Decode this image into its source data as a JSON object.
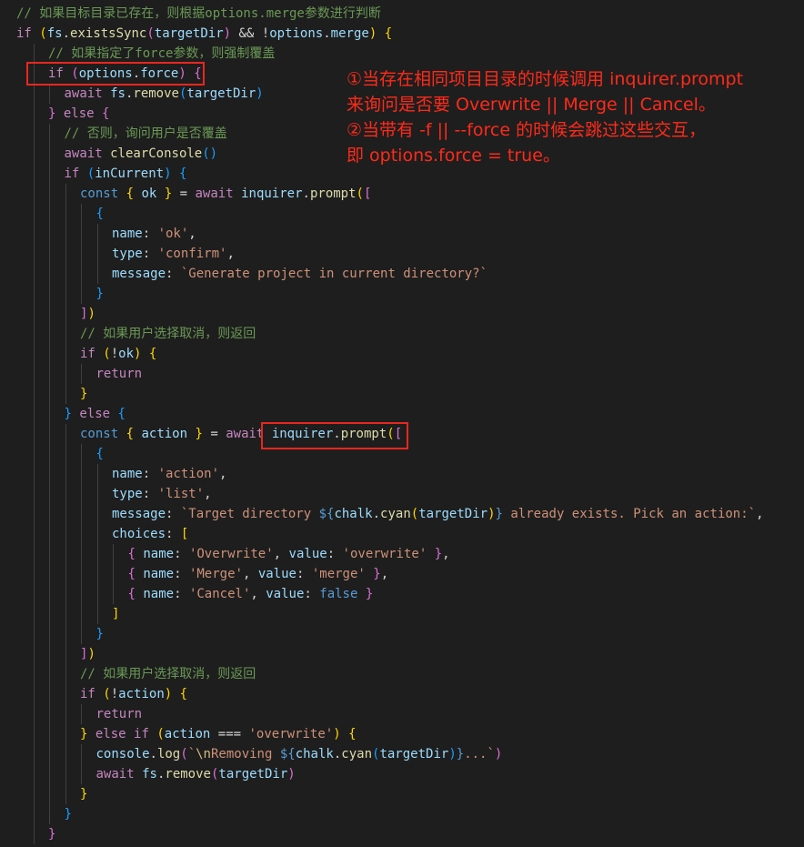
{
  "editor": {
    "lines": [
      {
        "indent": 1,
        "tokens": [
          [
            "c-cmt",
            "// 如果目标目录已存在，则根据options.merge参数进行判断"
          ]
        ]
      },
      {
        "indent": 0,
        "tokens": [
          [
            "c-ctl",
            "if"
          ],
          [
            "c-plain",
            " "
          ],
          [
            "c-br1",
            "("
          ],
          [
            "c-var",
            "fs"
          ],
          [
            "c-plain",
            "."
          ],
          [
            "c-fn",
            "existsSync"
          ],
          [
            "c-br2",
            "("
          ],
          [
            "c-var",
            "targetDir"
          ],
          [
            "c-br2",
            ")"
          ],
          [
            "c-plain",
            " && !"
          ],
          [
            "c-var",
            "options"
          ],
          [
            "c-plain",
            "."
          ],
          [
            "c-var",
            "merge"
          ],
          [
            "c-br1",
            ")"
          ],
          [
            "c-plain",
            " "
          ],
          [
            "c-br1",
            "{"
          ]
        ]
      },
      {
        "indent": 2,
        "tokens": [
          [
            "c-cmt",
            "// 如果指定了force参数，则强制覆盖"
          ]
        ]
      },
      {
        "indent": 2,
        "tokens": [
          [
            "c-ctl",
            "if"
          ],
          [
            "c-plain",
            " "
          ],
          [
            "c-br2",
            "("
          ],
          [
            "c-var",
            "options"
          ],
          [
            "c-plain",
            "."
          ],
          [
            "c-var",
            "force"
          ],
          [
            "c-br2",
            ")"
          ],
          [
            "c-plain",
            " "
          ],
          [
            "c-br2",
            "{"
          ]
        ]
      },
      {
        "indent": 3,
        "tokens": [
          [
            "c-ctl",
            "await"
          ],
          [
            "c-plain",
            " "
          ],
          [
            "c-var",
            "fs"
          ],
          [
            "c-plain",
            "."
          ],
          [
            "c-fn",
            "remove"
          ],
          [
            "c-br3",
            "("
          ],
          [
            "c-var",
            "targetDir"
          ],
          [
            "c-br3",
            ")"
          ]
        ]
      },
      {
        "indent": 2,
        "tokens": [
          [
            "c-br2",
            "}"
          ],
          [
            "c-plain",
            " "
          ],
          [
            "c-ctl",
            "else"
          ],
          [
            "c-plain",
            " "
          ],
          [
            "c-br2",
            "{"
          ]
        ]
      },
      {
        "indent": 3,
        "tokens": [
          [
            "c-cmt",
            "// 否则，询问用户是否覆盖"
          ]
        ]
      },
      {
        "indent": 3,
        "tokens": [
          [
            "c-ctl",
            "await"
          ],
          [
            "c-plain",
            " "
          ],
          [
            "c-fn",
            "clearConsole"
          ],
          [
            "c-br3",
            "()"
          ]
        ]
      },
      {
        "indent": 3,
        "tokens": [
          [
            "c-ctl",
            "if"
          ],
          [
            "c-plain",
            " "
          ],
          [
            "c-br3",
            "("
          ],
          [
            "c-var",
            "inCurrent"
          ],
          [
            "c-br3",
            ")"
          ],
          [
            "c-plain",
            " "
          ],
          [
            "c-br3",
            "{"
          ]
        ]
      },
      {
        "indent": 4,
        "tokens": [
          [
            "c-const",
            "const"
          ],
          [
            "c-plain",
            " "
          ],
          [
            "c-br1",
            "{"
          ],
          [
            "c-plain",
            " "
          ],
          [
            "c-var",
            "ok"
          ],
          [
            "c-plain",
            " "
          ],
          [
            "c-br1",
            "}"
          ],
          [
            "c-plain",
            " = "
          ],
          [
            "c-ctl",
            "await"
          ],
          [
            "c-plain",
            " "
          ],
          [
            "c-var",
            "inquirer"
          ],
          [
            "c-plain",
            "."
          ],
          [
            "c-fn",
            "prompt"
          ],
          [
            "c-br1",
            "("
          ],
          [
            "c-br2",
            "["
          ]
        ]
      },
      {
        "indent": 5,
        "tokens": [
          [
            "c-br3",
            "{"
          ]
        ]
      },
      {
        "indent": 6,
        "tokens": [
          [
            "c-prop",
            "name"
          ],
          [
            "c-plain",
            ": "
          ],
          [
            "c-str",
            "'ok'"
          ],
          [
            "c-plain",
            ","
          ]
        ]
      },
      {
        "indent": 6,
        "tokens": [
          [
            "c-prop",
            "type"
          ],
          [
            "c-plain",
            ": "
          ],
          [
            "c-str",
            "'confirm'"
          ],
          [
            "c-plain",
            ","
          ]
        ]
      },
      {
        "indent": 6,
        "tokens": [
          [
            "c-prop",
            "message"
          ],
          [
            "c-plain",
            ": "
          ],
          [
            "c-str",
            "`Generate project in current directory?`"
          ]
        ]
      },
      {
        "indent": 5,
        "tokens": [
          [
            "c-br3",
            "}"
          ]
        ]
      },
      {
        "indent": 4,
        "tokens": [
          [
            "c-br2",
            "]"
          ],
          [
            "c-br1",
            ")"
          ]
        ]
      },
      {
        "indent": 4,
        "tokens": [
          [
            "c-cmt",
            "// 如果用户选择取消，则返回"
          ]
        ]
      },
      {
        "indent": 4,
        "tokens": [
          [
            "c-ctl",
            "if"
          ],
          [
            "c-plain",
            " "
          ],
          [
            "c-br1",
            "("
          ],
          [
            "c-plain",
            "!"
          ],
          [
            "c-var",
            "ok"
          ],
          [
            "c-br1",
            ")"
          ],
          [
            "c-plain",
            " "
          ],
          [
            "c-br1",
            "{"
          ]
        ]
      },
      {
        "indent": 5,
        "tokens": [
          [
            "c-ctl",
            "return"
          ]
        ]
      },
      {
        "indent": 4,
        "tokens": [
          [
            "c-br1",
            "}"
          ]
        ]
      },
      {
        "indent": 3,
        "tokens": [
          [
            "c-br3",
            "}"
          ],
          [
            "c-plain",
            " "
          ],
          [
            "c-ctl",
            "else"
          ],
          [
            "c-plain",
            " "
          ],
          [
            "c-br3",
            "{"
          ]
        ]
      },
      {
        "indent": 4,
        "tokens": [
          [
            "c-const",
            "const"
          ],
          [
            "c-plain",
            " "
          ],
          [
            "c-br1",
            "{"
          ],
          [
            "c-plain",
            " "
          ],
          [
            "c-var",
            "action"
          ],
          [
            "c-plain",
            " "
          ],
          [
            "c-br1",
            "}"
          ],
          [
            "c-plain",
            " = "
          ],
          [
            "c-ctl",
            "await"
          ],
          [
            "c-plain",
            " "
          ],
          [
            "c-var",
            "inquirer"
          ],
          [
            "c-plain",
            "."
          ],
          [
            "c-fn",
            "prompt"
          ],
          [
            "c-br1",
            "("
          ],
          [
            "c-br2",
            "["
          ]
        ]
      },
      {
        "indent": 5,
        "tokens": [
          [
            "c-br3",
            "{"
          ]
        ]
      },
      {
        "indent": 6,
        "tokens": [
          [
            "c-prop",
            "name"
          ],
          [
            "c-plain",
            ": "
          ],
          [
            "c-str",
            "'action'"
          ],
          [
            "c-plain",
            ","
          ]
        ]
      },
      {
        "indent": 6,
        "tokens": [
          [
            "c-prop",
            "type"
          ],
          [
            "c-plain",
            ": "
          ],
          [
            "c-str",
            "'list'"
          ],
          [
            "c-plain",
            ","
          ]
        ]
      },
      {
        "indent": 6,
        "tokens": [
          [
            "c-prop",
            "message"
          ],
          [
            "c-plain",
            ": "
          ],
          [
            "c-str",
            "`Target directory "
          ],
          [
            "c-const",
            "${"
          ],
          [
            "c-var",
            "chalk"
          ],
          [
            "c-plain",
            "."
          ],
          [
            "c-fn",
            "cyan"
          ],
          [
            "c-br1",
            "("
          ],
          [
            "c-var",
            "targetDir"
          ],
          [
            "c-br1",
            ")"
          ],
          [
            "c-const",
            "}"
          ],
          [
            "c-str",
            " already exists. Pick an action:`"
          ],
          [
            "c-plain",
            ","
          ]
        ]
      },
      {
        "indent": 6,
        "tokens": [
          [
            "c-prop",
            "choices"
          ],
          [
            "c-plain",
            ": "
          ],
          [
            "c-br1",
            "["
          ]
        ]
      },
      {
        "indent": 7,
        "tokens": [
          [
            "c-br2",
            "{"
          ],
          [
            "c-plain",
            " "
          ],
          [
            "c-prop",
            "name"
          ],
          [
            "c-plain",
            ": "
          ],
          [
            "c-str",
            "'Overwrite'"
          ],
          [
            "c-plain",
            ", "
          ],
          [
            "c-prop",
            "value"
          ],
          [
            "c-plain",
            ": "
          ],
          [
            "c-str",
            "'overwrite'"
          ],
          [
            "c-plain",
            " "
          ],
          [
            "c-br2",
            "}"
          ],
          [
            "c-plain",
            ","
          ]
        ]
      },
      {
        "indent": 7,
        "tokens": [
          [
            "c-br2",
            "{"
          ],
          [
            "c-plain",
            " "
          ],
          [
            "c-prop",
            "name"
          ],
          [
            "c-plain",
            ": "
          ],
          [
            "c-str",
            "'Merge'"
          ],
          [
            "c-plain",
            ", "
          ],
          [
            "c-prop",
            "value"
          ],
          [
            "c-plain",
            ": "
          ],
          [
            "c-str",
            "'merge'"
          ],
          [
            "c-plain",
            " "
          ],
          [
            "c-br2",
            "}"
          ],
          [
            "c-plain",
            ","
          ]
        ]
      },
      {
        "indent": 7,
        "tokens": [
          [
            "c-br2",
            "{"
          ],
          [
            "c-plain",
            " "
          ],
          [
            "c-prop",
            "name"
          ],
          [
            "c-plain",
            ": "
          ],
          [
            "c-str",
            "'Cancel'"
          ],
          [
            "c-plain",
            ", "
          ],
          [
            "c-prop",
            "value"
          ],
          [
            "c-plain",
            ": "
          ],
          [
            "c-const",
            "false"
          ],
          [
            "c-plain",
            " "
          ],
          [
            "c-br2",
            "}"
          ]
        ]
      },
      {
        "indent": 6,
        "tokens": [
          [
            "c-br1",
            "]"
          ]
        ]
      },
      {
        "indent": 5,
        "tokens": [
          [
            "c-br3",
            "}"
          ]
        ]
      },
      {
        "indent": 4,
        "tokens": [
          [
            "c-br2",
            "]"
          ],
          [
            "c-br1",
            ")"
          ]
        ]
      },
      {
        "indent": 4,
        "tokens": [
          [
            "c-cmt",
            "// 如果用户选择取消，则返回"
          ]
        ]
      },
      {
        "indent": 4,
        "tokens": [
          [
            "c-ctl",
            "if"
          ],
          [
            "c-plain",
            " "
          ],
          [
            "c-br1",
            "("
          ],
          [
            "c-plain",
            "!"
          ],
          [
            "c-var",
            "action"
          ],
          [
            "c-br1",
            ")"
          ],
          [
            "c-plain",
            " "
          ],
          [
            "c-br1",
            "{"
          ]
        ]
      },
      {
        "indent": 5,
        "tokens": [
          [
            "c-ctl",
            "return"
          ]
        ]
      },
      {
        "indent": 4,
        "tokens": [
          [
            "c-br1",
            "}"
          ],
          [
            "c-plain",
            " "
          ],
          [
            "c-ctl",
            "else"
          ],
          [
            "c-plain",
            " "
          ],
          [
            "c-ctl",
            "if"
          ],
          [
            "c-plain",
            " "
          ],
          [
            "c-br1",
            "("
          ],
          [
            "c-var",
            "action"
          ],
          [
            "c-plain",
            " === "
          ],
          [
            "c-str",
            "'overwrite'"
          ],
          [
            "c-br1",
            ")"
          ],
          [
            "c-plain",
            " "
          ],
          [
            "c-br1",
            "{"
          ]
        ]
      },
      {
        "indent": 5,
        "tokens": [
          [
            "c-var",
            "console"
          ],
          [
            "c-plain",
            "."
          ],
          [
            "c-fn",
            "log"
          ],
          [
            "c-br2",
            "("
          ],
          [
            "c-str",
            "`"
          ],
          [
            "c-esc",
            "\\n"
          ],
          [
            "c-str",
            "Removing "
          ],
          [
            "c-const",
            "${"
          ],
          [
            "c-var",
            "chalk"
          ],
          [
            "c-plain",
            "."
          ],
          [
            "c-fn",
            "cyan"
          ],
          [
            "c-br3",
            "("
          ],
          [
            "c-var",
            "targetDir"
          ],
          [
            "c-br3",
            ")"
          ],
          [
            "c-const",
            "}"
          ],
          [
            "c-str",
            "...`"
          ],
          [
            "c-br2",
            ")"
          ]
        ]
      },
      {
        "indent": 5,
        "tokens": [
          [
            "c-ctl",
            "await"
          ],
          [
            "c-plain",
            " "
          ],
          [
            "c-var",
            "fs"
          ],
          [
            "c-plain",
            "."
          ],
          [
            "c-fn",
            "remove"
          ],
          [
            "c-br2",
            "("
          ],
          [
            "c-var",
            "targetDir"
          ],
          [
            "c-br2",
            ")"
          ]
        ]
      },
      {
        "indent": 4,
        "tokens": [
          [
            "c-br1",
            "}"
          ]
        ]
      },
      {
        "indent": 3,
        "tokens": [
          [
            "c-br3",
            "}"
          ]
        ]
      },
      {
        "indent": 2,
        "tokens": [
          [
            "c-br2",
            "}"
          ]
        ]
      }
    ]
  },
  "annotation": {
    "lines": [
      "①当存在相同项目目录的时候调用 inquirer.prompt",
      "来询问是否要 Overwrite || Merge || Cancel。",
      "②当带有 -f || --force 的时候会跳过这些交互，",
      "即 options.force = true。"
    ],
    "color": "#ff2a1a"
  },
  "colors": {
    "background": "#1e1e1e",
    "highlight_box": "#e8271f"
  }
}
